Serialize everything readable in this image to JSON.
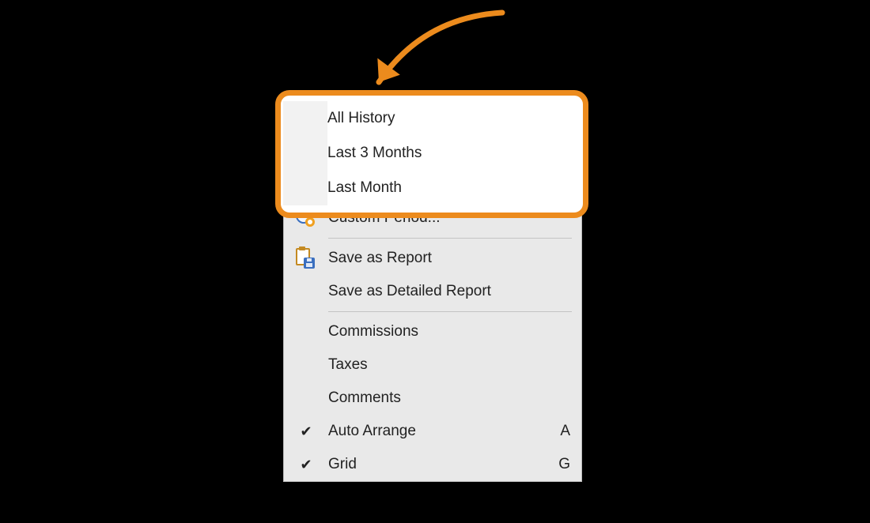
{
  "callout": {
    "items": [
      {
        "label": "All History"
      },
      {
        "label": "Last 3 Months"
      },
      {
        "label": "Last Month"
      }
    ]
  },
  "menu": {
    "customPeriod": {
      "label": "Custom Period...",
      "icon": "clock-gear-icon"
    },
    "saveReport": {
      "label": "Save as Report",
      "icon": "save-report-icon"
    },
    "saveDetailed": {
      "label": "Save as Detailed Report"
    },
    "commissions": {
      "label": "Commissions"
    },
    "taxes": {
      "label": "Taxes"
    },
    "comments": {
      "label": "Comments"
    },
    "autoArrange": {
      "label": "Auto Arrange",
      "checked": true,
      "accel": "A"
    },
    "grid": {
      "label": "Grid",
      "checked": true,
      "accel": "G"
    }
  },
  "accent": {
    "highlight": "#ec8b1d"
  }
}
